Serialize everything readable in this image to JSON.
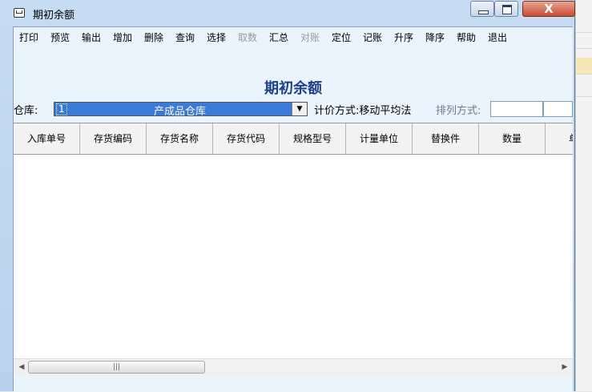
{
  "window": {
    "title": "期初余额",
    "minimize": "_",
    "maximize": "□",
    "close": "X"
  },
  "menu": [
    {
      "label": "打印",
      "enabled": true
    },
    {
      "label": "预览",
      "enabled": true
    },
    {
      "label": "输出",
      "enabled": true
    },
    {
      "label": "增加",
      "enabled": true
    },
    {
      "label": "删除",
      "enabled": true
    },
    {
      "label": "查询",
      "enabled": true
    },
    {
      "label": "选择",
      "enabled": true
    },
    {
      "label": "取数",
      "enabled": false
    },
    {
      "label": "汇总",
      "enabled": true
    },
    {
      "label": "对账",
      "enabled": false
    },
    {
      "label": "定位",
      "enabled": true
    },
    {
      "label": "记账",
      "enabled": true
    },
    {
      "label": "升序",
      "enabled": true
    },
    {
      "label": "降序",
      "enabled": true
    },
    {
      "label": "帮助",
      "enabled": true
    },
    {
      "label": "退出",
      "enabled": true
    }
  ],
  "form": {
    "title": "期初余额",
    "warehouse_label": "仓库:",
    "warehouse_code": "1",
    "warehouse_name": "产成品仓库",
    "pricing_label": "计价方式:移动平均法",
    "sort_label": "排列方式:"
  },
  "grid": {
    "columns": [
      "入库单号",
      "存货编码",
      "存货名称",
      "存货代码",
      "规格型号",
      "计量单位",
      "替换件",
      "数量",
      "单"
    ]
  },
  "scrollbar": {
    "left_arrow": "◀",
    "right_arrow": "▶",
    "thumb_grip": "|||"
  },
  "colors": {
    "title_blue": "#1c3f8a",
    "selection_blue": "#3b7bd8",
    "client_bg": "#eaf4fc"
  }
}
